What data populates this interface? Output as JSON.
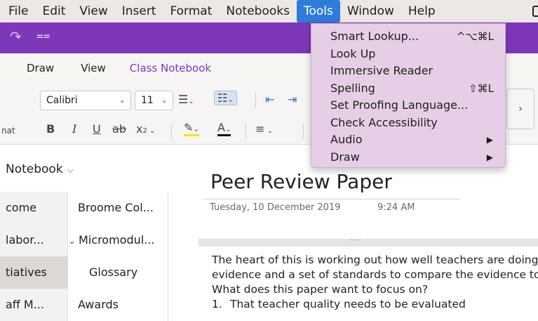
{
  "menubar": {
    "items": [
      "File",
      "Edit",
      "View",
      "Insert",
      "Format",
      "Notebooks",
      "Tools",
      "Window",
      "Help"
    ],
    "active": "Tools"
  },
  "quick_access": {
    "redo_icon": "redo-icon",
    "customize_icon": "customize-icon"
  },
  "ribbon": {
    "tabs": [
      "Draw",
      "View",
      "Class Notebook"
    ],
    "font_name": "Calibri",
    "font_size": "11"
  },
  "notebook": {
    "title": "Notebook"
  },
  "sections": [
    "come",
    "labor...",
    "tiatives",
    "aff M..."
  ],
  "pages": [
    "Broome Col...",
    "Micromodul...",
    "Glossary",
    "Awards"
  ],
  "page": {
    "title": "Peer Review Paper",
    "date": "Tuesday, 10 December 2019",
    "time": "9:24 AM",
    "paragraph_lines": [
      "The heart of this is working out how well teachers are doing.",
      "evidence and a set of standards to compare the evidence to.",
      "What does this paper want to focus on?"
    ],
    "list": [
      {
        "num": "1.",
        "text": "That teacher quality needs to be evaluated"
      }
    ]
  },
  "tools_menu": [
    {
      "label": "Smart Lookup...",
      "shortcut": "^⌥⌘L"
    },
    {
      "label": "Look Up",
      "shortcut": ""
    },
    {
      "label": "Immersive Reader",
      "shortcut": ""
    },
    {
      "label": "Spelling",
      "shortcut": "⇧⌘L"
    },
    {
      "label": "Set Proofing Language...",
      "shortcut": ""
    },
    {
      "label": "Check Accessibility",
      "shortcut": ""
    },
    {
      "label": "Audio",
      "shortcut": "▶"
    },
    {
      "label": "Draw",
      "shortcut": "▶"
    }
  ],
  "colors": {
    "accent": "#7d37b8",
    "menu_active": "#2f7bd9",
    "dropdown_bg": "#e6cfe6"
  }
}
